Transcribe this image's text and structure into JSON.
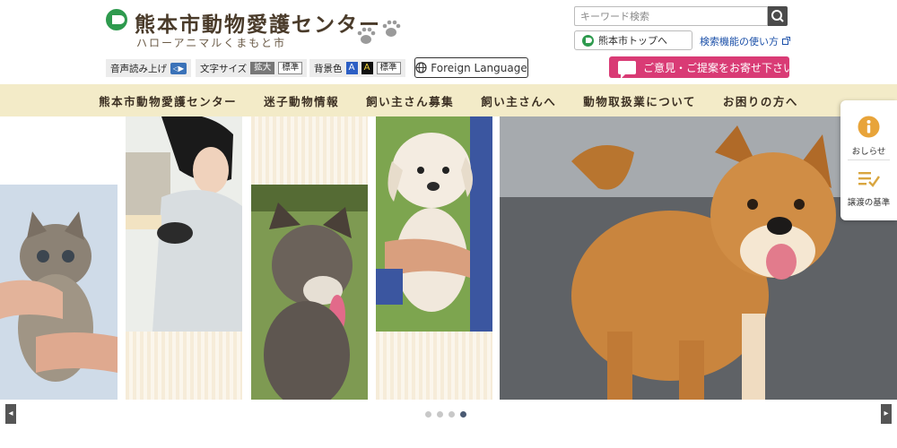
{
  "header": {
    "title": "熊本市動物愛護センター",
    "subtitle": "ハローアニマルくまもと市"
  },
  "search": {
    "placeholder": "キーワード検索",
    "top_link": "熊本市トップへ",
    "help_link": "検索機能の使い方"
  },
  "tools": {
    "read_aloud": "音声読み上げ",
    "font_size": "文字サイズ",
    "font_large": "拡大",
    "font_normal": "標準",
    "bg_color": "背景色",
    "bg_a1": "A",
    "bg_a2": "A",
    "bg_normal": "標準"
  },
  "foreign_language": "Foreign Language",
  "opinion": "ご意見・ご提案をお寄せ下さい",
  "nav": [
    {
      "label": "熊本市動物愛護センター"
    },
    {
      "label": "迷子動物情報"
    },
    {
      "label": "飼い主さん募集"
    },
    {
      "label": "飼い主さんへ"
    },
    {
      "label": "動物取扱業について"
    },
    {
      "label": "お困りの方へ"
    }
  ],
  "side": {
    "notice": "おしらせ",
    "criteria": "譲渡の基準"
  },
  "slider": {
    "dot_count": 4,
    "active_index": 3
  },
  "colors": {
    "brand_green": "#2e9a4e",
    "nav_bg": "#f3ebc8",
    "opinion_pink": "#d93b75",
    "notice_orange": "#e8a43a"
  },
  "icons": [
    "search-icon",
    "globe-icon",
    "speech-bubble-icon",
    "info-icon",
    "checklist-icon",
    "paw-icon",
    "external-link-icon"
  ]
}
